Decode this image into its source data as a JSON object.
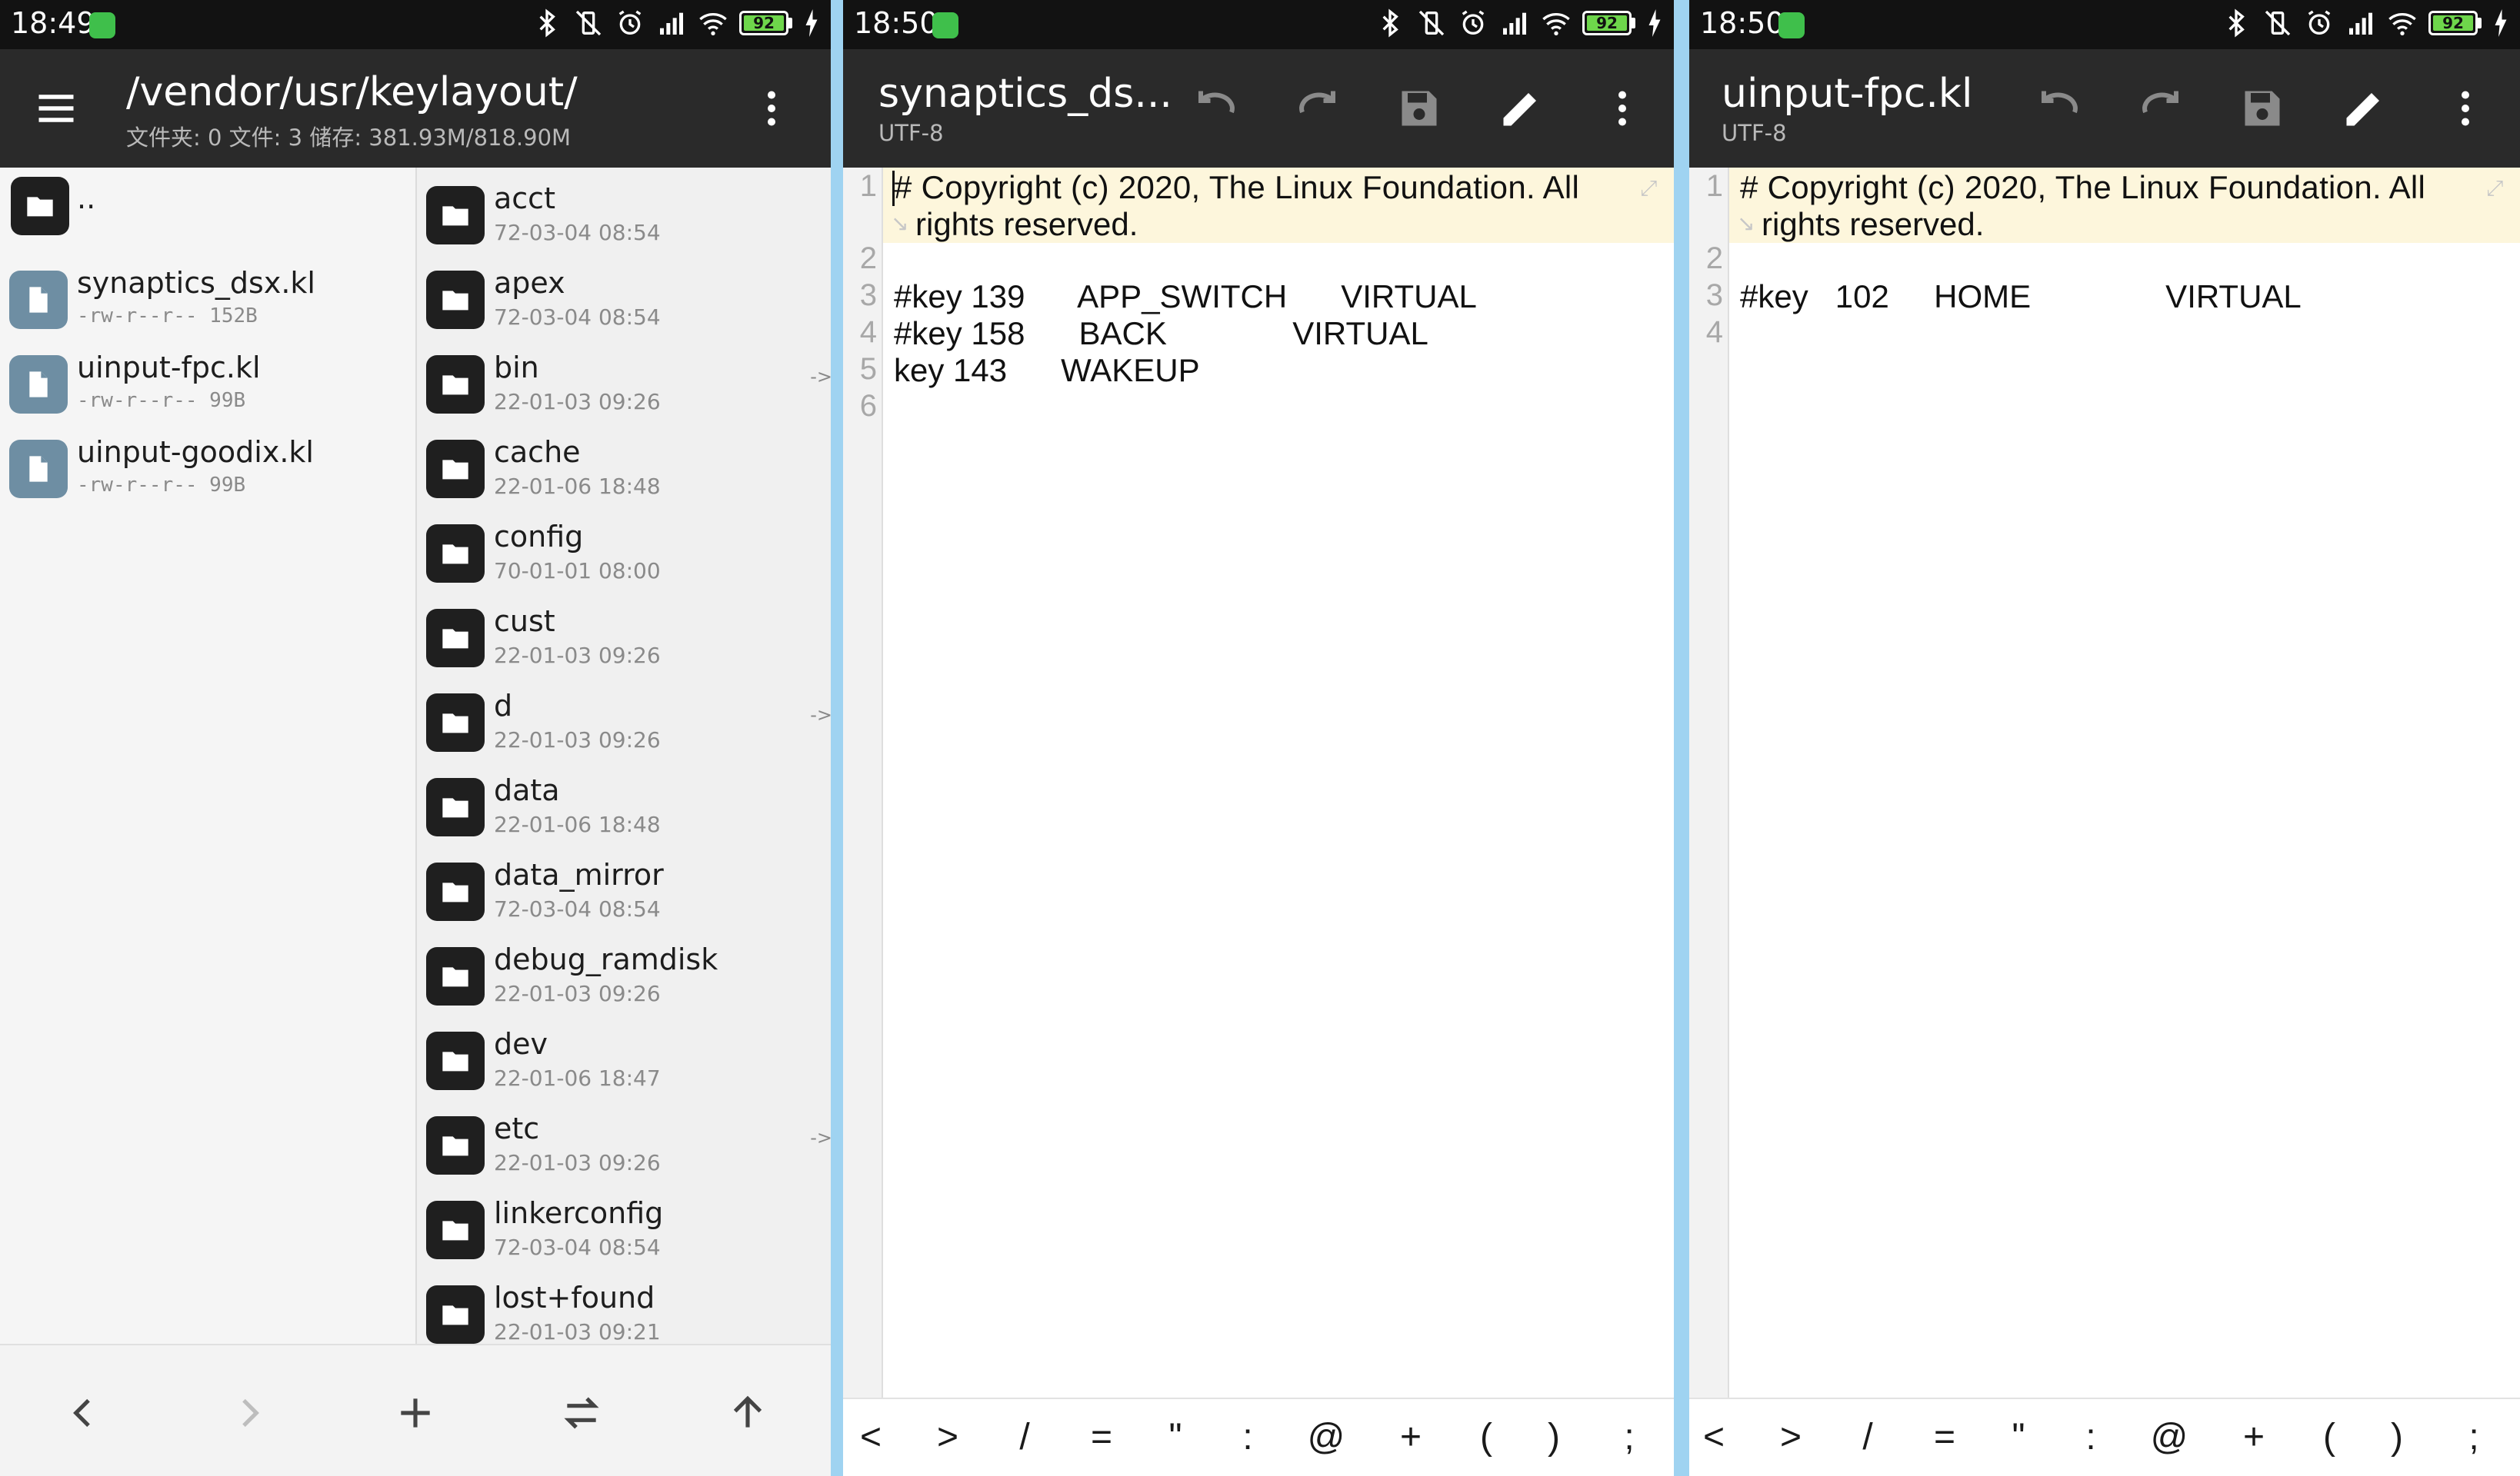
{
  "colors": {
    "toolbar": "#2a2a2a",
    "statusbar": "#121212",
    "divider": "#9fd3f1",
    "highlight_line": "#fdf6dc",
    "battery": "#6ed64b"
  },
  "file_manager": {
    "status": {
      "time": "18:49",
      "battery": "92"
    },
    "path": "/vendor/usr/keylayout/",
    "summary": "文件夹: 0   文件: 3   储存: 381.93M/818.90M",
    "left_list": [
      {
        "name": "..",
        "meta": "",
        "icon": "folder-icon"
      },
      {
        "name": "synaptics_dsx.kl",
        "meta": "-rw-r--r-- 152B",
        "icon": "file-icon"
      },
      {
        "name": "uinput-fpc.kl",
        "meta": "-rw-r--r-- 99B",
        "icon": "file-icon"
      },
      {
        "name": "uinput-goodix.kl",
        "meta": "-rw-r--r-- 99B",
        "icon": "file-icon"
      }
    ],
    "right_list": [
      {
        "name": "acct",
        "meta": "72-03-04 08:54",
        "arrow": ""
      },
      {
        "name": "apex",
        "meta": "72-03-04 08:54",
        "arrow": ""
      },
      {
        "name": "bin",
        "meta": "22-01-03 09:26",
        "arrow": "->"
      },
      {
        "name": "cache",
        "meta": "22-01-06 18:48",
        "arrow": ""
      },
      {
        "name": "config",
        "meta": "70-01-01 08:00",
        "arrow": ""
      },
      {
        "name": "cust",
        "meta": "22-01-03 09:26",
        "arrow": ""
      },
      {
        "name": "d",
        "meta": "22-01-03 09:26",
        "arrow": "->"
      },
      {
        "name": "data",
        "meta": "22-01-06 18:48",
        "arrow": ""
      },
      {
        "name": "data_mirror",
        "meta": "72-03-04 08:54",
        "arrow": ""
      },
      {
        "name": "debug_ramdisk",
        "meta": "22-01-03 09:26",
        "arrow": ""
      },
      {
        "name": "dev",
        "meta": "22-01-06 18:47",
        "arrow": ""
      },
      {
        "name": "etc",
        "meta": "22-01-03 09:26",
        "arrow": "->"
      },
      {
        "name": "linkerconfig",
        "meta": "72-03-04 08:54",
        "arrow": ""
      },
      {
        "name": "lost+found",
        "meta": "22-01-03 09:21",
        "arrow": ""
      }
    ]
  },
  "editor1": {
    "status": {
      "time": "18:50",
      "battery": "92"
    },
    "title": "synaptics_ds...",
    "encoding": "UTF-8",
    "line_numbers": [
      "1",
      "2",
      "3",
      "4",
      "5",
      "6"
    ],
    "lines": [
      {
        "n": "1",
        "text": "# Copyright (c) 2020, The Linux Foundation. All"
      },
      {
        "n": "1b",
        "text": "rights reserved."
      },
      {
        "n": "2",
        "text": ""
      },
      {
        "n": "3",
        "text": "#key 139      APP_SWITCH      VIRTUAL"
      },
      {
        "n": "4",
        "text": "#key 158      BACK              VIRTUAL"
      },
      {
        "n": "5",
        "text": "key 143      WAKEUP"
      },
      {
        "n": "6",
        "text": ""
      }
    ],
    "symbols": [
      "<",
      ">",
      "/",
      "=",
      "\"",
      ":",
      "@",
      "+",
      "(",
      ")",
      ";"
    ]
  },
  "editor2": {
    "status": {
      "time": "18:50",
      "battery": "92"
    },
    "title": "uinput-fpc.kl",
    "encoding": "UTF-8",
    "line_numbers": [
      "1",
      "2",
      "3",
      "4"
    ],
    "lines": [
      {
        "n": "1",
        "text": "# Copyright (c) 2020, The Linux Foundation. All"
      },
      {
        "n": "1b",
        "text": "rights reserved."
      },
      {
        "n": "2",
        "text": ""
      },
      {
        "n": "3",
        "text": "#key   102     HOME               VIRTUAL"
      },
      {
        "n": "4",
        "text": ""
      }
    ],
    "symbols": [
      "<",
      ">",
      "/",
      "=",
      "\"",
      ":",
      "@",
      "+",
      "(",
      ")",
      ";"
    ]
  }
}
